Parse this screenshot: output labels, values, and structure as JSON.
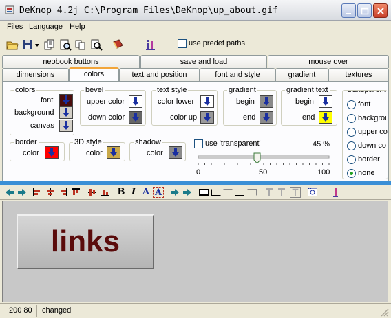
{
  "window": {
    "title": "DeKnop 4.2j C:\\Program Files\\DeKnop\\up_about.gif"
  },
  "menu": [
    "Files",
    "Language",
    "Help"
  ],
  "toolbar": {
    "predef_label": "use predef paths",
    "predef_checked": false
  },
  "tabs_top": [
    "neobook buttons",
    "save and load",
    "mouse over"
  ],
  "tabs_bottom": [
    "dimensions",
    "colors",
    "text and position",
    "font and style",
    "gradient",
    "textures"
  ],
  "active_tab": "colors",
  "colors_group": {
    "title": "colors",
    "font": "font",
    "background": "background",
    "canvas": "canvas"
  },
  "bevel_group": {
    "title": "bevel",
    "upper": "upper  color",
    "down": "down color"
  },
  "textstyle_group": {
    "title": "text style",
    "lower": "color lower",
    "up": "color up"
  },
  "gradient_group": {
    "title": "gradient",
    "begin": "begin",
    "end": "end"
  },
  "gradtext_group": {
    "title": "gradient text",
    "begin": "begin",
    "end": "end"
  },
  "transparent_group": {
    "title": "transparent",
    "options": [
      "font",
      "backgrou",
      "upper co",
      "down co",
      "border",
      "none"
    ],
    "selected": "none"
  },
  "border_group": {
    "title": "border",
    "color": "color"
  },
  "style3d_group": {
    "title": "3D style",
    "color": "color"
  },
  "shadow_group": {
    "title": "shadow",
    "color": "color"
  },
  "transparency": {
    "label": "use 'transparent'",
    "checked": false,
    "percent": "45 %",
    "value": 45,
    "min": "0",
    "mid": "50",
    "max": "100"
  },
  "swatches": {
    "font": "#4a0c0c",
    "background": "#d4d0c8",
    "canvas": "#d4d0c8",
    "bevel_upper": "#ffffff",
    "bevel_down": "#666666",
    "text_lower": "#ffffff",
    "text_up": "#9a9a9a",
    "grad_begin": "#8a8a8a",
    "grad_end": "#8a8a8a",
    "gradtext_begin": "#ffffff",
    "gradtext_end": "#ffff00",
    "border": "#ff0000",
    "style3d": "#c9a94a",
    "shadow": "#8a8a8a"
  },
  "preview": {
    "text": "links",
    "text_color": "#5a0b0b"
  },
  "status": {
    "coords": "200 80",
    "state": "changed"
  },
  "toolbar2_glyphs": [
    "B",
    "I",
    "A",
    "A"
  ]
}
